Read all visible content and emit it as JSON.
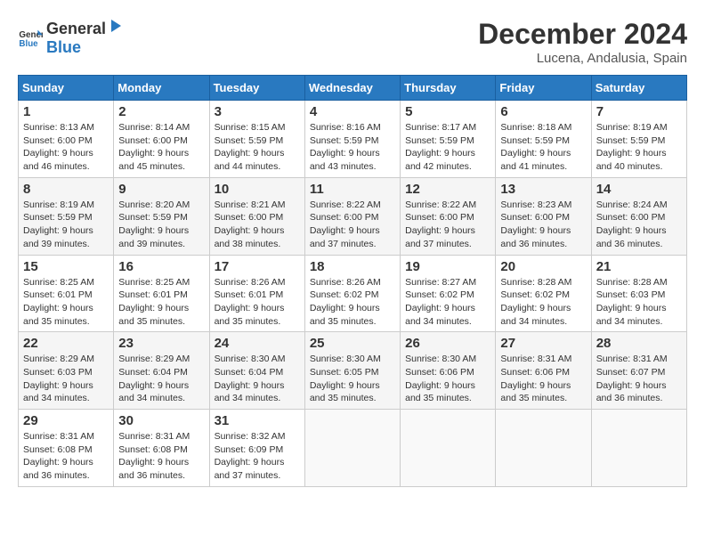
{
  "logo": {
    "general": "General",
    "blue": "Blue"
  },
  "title": "December 2024",
  "location": "Lucena, Andalusia, Spain",
  "weekdays": [
    "Sunday",
    "Monday",
    "Tuesday",
    "Wednesday",
    "Thursday",
    "Friday",
    "Saturday"
  ],
  "weeks": [
    [
      {
        "day": "1",
        "sunrise": "Sunrise: 8:13 AM",
        "sunset": "Sunset: 6:00 PM",
        "daylight": "Daylight: 9 hours and 46 minutes."
      },
      {
        "day": "2",
        "sunrise": "Sunrise: 8:14 AM",
        "sunset": "Sunset: 6:00 PM",
        "daylight": "Daylight: 9 hours and 45 minutes."
      },
      {
        "day": "3",
        "sunrise": "Sunrise: 8:15 AM",
        "sunset": "Sunset: 5:59 PM",
        "daylight": "Daylight: 9 hours and 44 minutes."
      },
      {
        "day": "4",
        "sunrise": "Sunrise: 8:16 AM",
        "sunset": "Sunset: 5:59 PM",
        "daylight": "Daylight: 9 hours and 43 minutes."
      },
      {
        "day": "5",
        "sunrise": "Sunrise: 8:17 AM",
        "sunset": "Sunset: 5:59 PM",
        "daylight": "Daylight: 9 hours and 42 minutes."
      },
      {
        "day": "6",
        "sunrise": "Sunrise: 8:18 AM",
        "sunset": "Sunset: 5:59 PM",
        "daylight": "Daylight: 9 hours and 41 minutes."
      },
      {
        "day": "7",
        "sunrise": "Sunrise: 8:19 AM",
        "sunset": "Sunset: 5:59 PM",
        "daylight": "Daylight: 9 hours and 40 minutes."
      }
    ],
    [
      {
        "day": "8",
        "sunrise": "Sunrise: 8:19 AM",
        "sunset": "Sunset: 5:59 PM",
        "daylight": "Daylight: 9 hours and 39 minutes."
      },
      {
        "day": "9",
        "sunrise": "Sunrise: 8:20 AM",
        "sunset": "Sunset: 5:59 PM",
        "daylight": "Daylight: 9 hours and 39 minutes."
      },
      {
        "day": "10",
        "sunrise": "Sunrise: 8:21 AM",
        "sunset": "Sunset: 6:00 PM",
        "daylight": "Daylight: 9 hours and 38 minutes."
      },
      {
        "day": "11",
        "sunrise": "Sunrise: 8:22 AM",
        "sunset": "Sunset: 6:00 PM",
        "daylight": "Daylight: 9 hours and 37 minutes."
      },
      {
        "day": "12",
        "sunrise": "Sunrise: 8:22 AM",
        "sunset": "Sunset: 6:00 PM",
        "daylight": "Daylight: 9 hours and 37 minutes."
      },
      {
        "day": "13",
        "sunrise": "Sunrise: 8:23 AM",
        "sunset": "Sunset: 6:00 PM",
        "daylight": "Daylight: 9 hours and 36 minutes."
      },
      {
        "day": "14",
        "sunrise": "Sunrise: 8:24 AM",
        "sunset": "Sunset: 6:00 PM",
        "daylight": "Daylight: 9 hours and 36 minutes."
      }
    ],
    [
      {
        "day": "15",
        "sunrise": "Sunrise: 8:25 AM",
        "sunset": "Sunset: 6:01 PM",
        "daylight": "Daylight: 9 hours and 35 minutes."
      },
      {
        "day": "16",
        "sunrise": "Sunrise: 8:25 AM",
        "sunset": "Sunset: 6:01 PM",
        "daylight": "Daylight: 9 hours and 35 minutes."
      },
      {
        "day": "17",
        "sunrise": "Sunrise: 8:26 AM",
        "sunset": "Sunset: 6:01 PM",
        "daylight": "Daylight: 9 hours and 35 minutes."
      },
      {
        "day": "18",
        "sunrise": "Sunrise: 8:26 AM",
        "sunset": "Sunset: 6:02 PM",
        "daylight": "Daylight: 9 hours and 35 minutes."
      },
      {
        "day": "19",
        "sunrise": "Sunrise: 8:27 AM",
        "sunset": "Sunset: 6:02 PM",
        "daylight": "Daylight: 9 hours and 34 minutes."
      },
      {
        "day": "20",
        "sunrise": "Sunrise: 8:28 AM",
        "sunset": "Sunset: 6:02 PM",
        "daylight": "Daylight: 9 hours and 34 minutes."
      },
      {
        "day": "21",
        "sunrise": "Sunrise: 8:28 AM",
        "sunset": "Sunset: 6:03 PM",
        "daylight": "Daylight: 9 hours and 34 minutes."
      }
    ],
    [
      {
        "day": "22",
        "sunrise": "Sunrise: 8:29 AM",
        "sunset": "Sunset: 6:03 PM",
        "daylight": "Daylight: 9 hours and 34 minutes."
      },
      {
        "day": "23",
        "sunrise": "Sunrise: 8:29 AM",
        "sunset": "Sunset: 6:04 PM",
        "daylight": "Daylight: 9 hours and 34 minutes."
      },
      {
        "day": "24",
        "sunrise": "Sunrise: 8:30 AM",
        "sunset": "Sunset: 6:04 PM",
        "daylight": "Daylight: 9 hours and 34 minutes."
      },
      {
        "day": "25",
        "sunrise": "Sunrise: 8:30 AM",
        "sunset": "Sunset: 6:05 PM",
        "daylight": "Daylight: 9 hours and 35 minutes."
      },
      {
        "day": "26",
        "sunrise": "Sunrise: 8:30 AM",
        "sunset": "Sunset: 6:06 PM",
        "daylight": "Daylight: 9 hours and 35 minutes."
      },
      {
        "day": "27",
        "sunrise": "Sunrise: 8:31 AM",
        "sunset": "Sunset: 6:06 PM",
        "daylight": "Daylight: 9 hours and 35 minutes."
      },
      {
        "day": "28",
        "sunrise": "Sunrise: 8:31 AM",
        "sunset": "Sunset: 6:07 PM",
        "daylight": "Daylight: 9 hours and 36 minutes."
      }
    ],
    [
      {
        "day": "29",
        "sunrise": "Sunrise: 8:31 AM",
        "sunset": "Sunset: 6:08 PM",
        "daylight": "Daylight: 9 hours and 36 minutes."
      },
      {
        "day": "30",
        "sunrise": "Sunrise: 8:31 AM",
        "sunset": "Sunset: 6:08 PM",
        "daylight": "Daylight: 9 hours and 36 minutes."
      },
      {
        "day": "31",
        "sunrise": "Sunrise: 8:32 AM",
        "sunset": "Sunset: 6:09 PM",
        "daylight": "Daylight: 9 hours and 37 minutes."
      },
      null,
      null,
      null,
      null
    ]
  ]
}
